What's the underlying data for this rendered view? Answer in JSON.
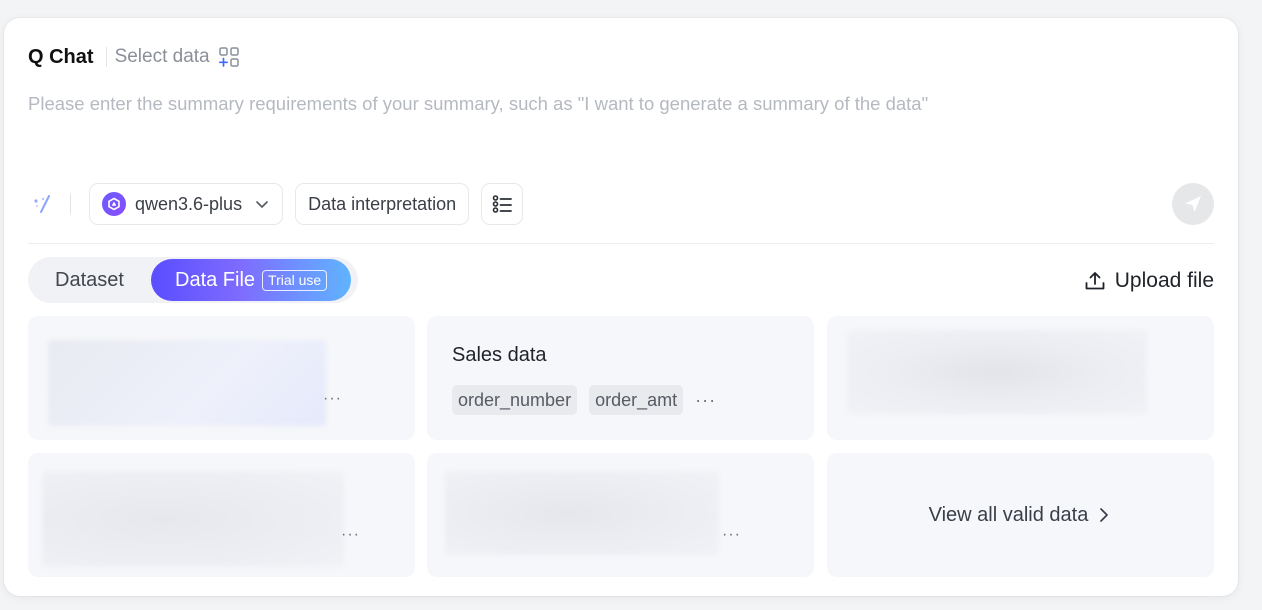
{
  "header": {
    "app_title": "Q Chat",
    "select_data_label": "Select data",
    "select_data_icon": "grid-add-icon"
  },
  "prompt": {
    "placeholder": "Please enter the summary requirements of your summary, such as \"I want to generate a summary of the data\"",
    "value": ""
  },
  "toolbar": {
    "wand_icon": "magic-wand-icon",
    "model": {
      "name": "qwen3.6-plus",
      "icon": "model-logo-icon",
      "accent": "#6a5cff"
    },
    "mode_label": "Data interpretation",
    "list_icon": "list-settings-icon",
    "send_icon": "send-icon"
  },
  "tabs": {
    "items": [
      {
        "label": "Dataset",
        "active": false
      },
      {
        "label": "Data File",
        "active": true,
        "badge": "Trial use"
      }
    ],
    "accent_start": "#5a4dff",
    "accent_end": "#5fb4ff"
  },
  "upload": {
    "label": "Upload file",
    "icon": "upload-icon"
  },
  "cards": [
    {
      "blurred": true
    },
    {
      "title": "Sales data",
      "tags": [
        "order_number",
        "order_amt"
      ],
      "more": "···"
    },
    {
      "blurred": true
    },
    {
      "blurred": true
    },
    {
      "blurred": true
    },
    {
      "view_all_label": "View all valid data"
    }
  ],
  "more_glyph": "···"
}
